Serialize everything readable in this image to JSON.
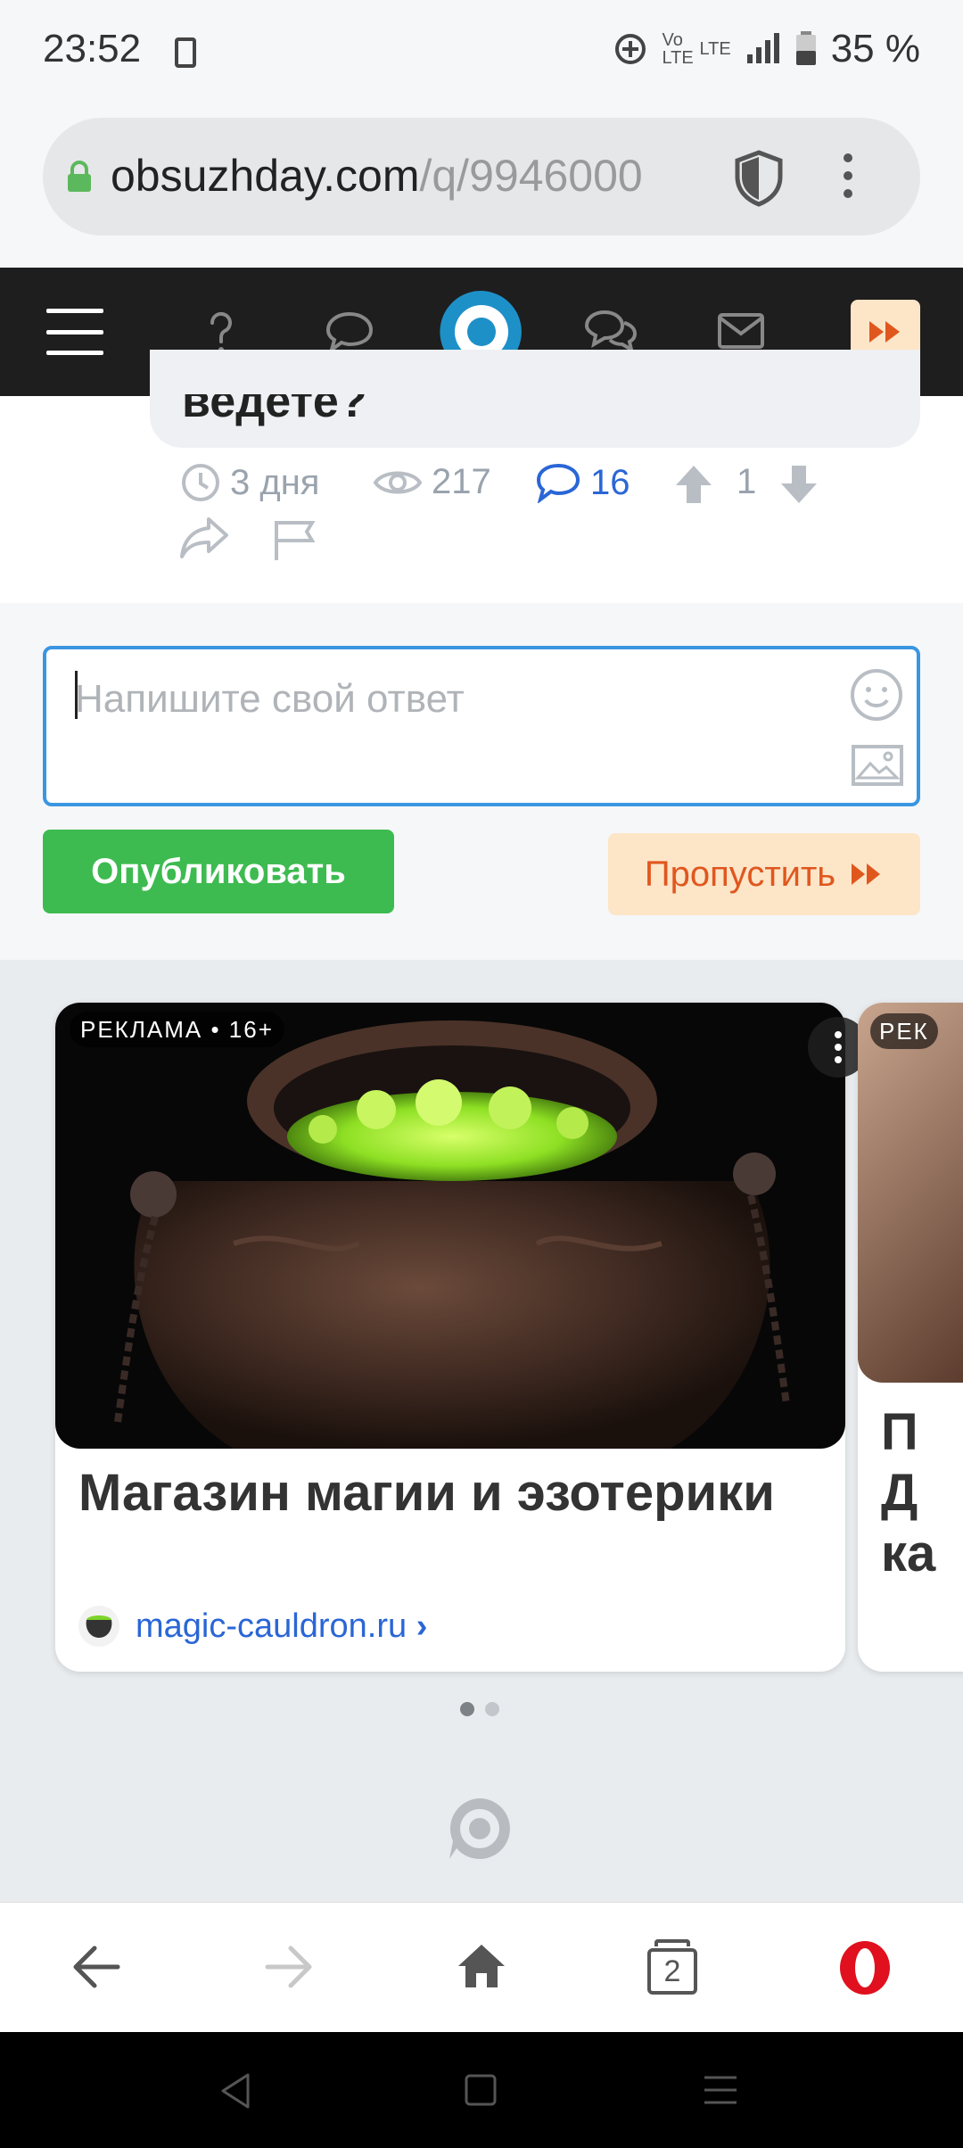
{
  "status_bar": {
    "time": "23:52",
    "battery": "35 %",
    "network": "LTE"
  },
  "browser": {
    "url_domain": "obsuzhday.com",
    "url_path": "/q/9946000",
    "tab_count": "2"
  },
  "site_nav": {
    "items": [
      "menu-icon",
      "question-icon",
      "comment-icon",
      "logo",
      "discussion-icon",
      "mail-icon",
      "skip-icon"
    ],
    "accent": "#fde5c8",
    "logo_color": "#1e90c8"
  },
  "question": {
    "title_tail": "ведете?",
    "age": "3 дня",
    "views": "217",
    "comments": "16",
    "votes": "1"
  },
  "answer": {
    "placeholder": "Напишите свой ответ",
    "publish_label": "Опубликовать",
    "skip_label": "Пропустить"
  },
  "ad": {
    "badge": "РЕКЛАМА • 16+",
    "title": "Магазин магии и эзотерики",
    "domain": "magic-cauldron.ru",
    "next_badge": "РЕК",
    "next_title_partial": "П\nД\nка"
  },
  "colors": {
    "publish": "#3dbb50",
    "skip_text": "#e0571e",
    "link": "#2a66d6",
    "comment_accent": "#2a66d6"
  }
}
